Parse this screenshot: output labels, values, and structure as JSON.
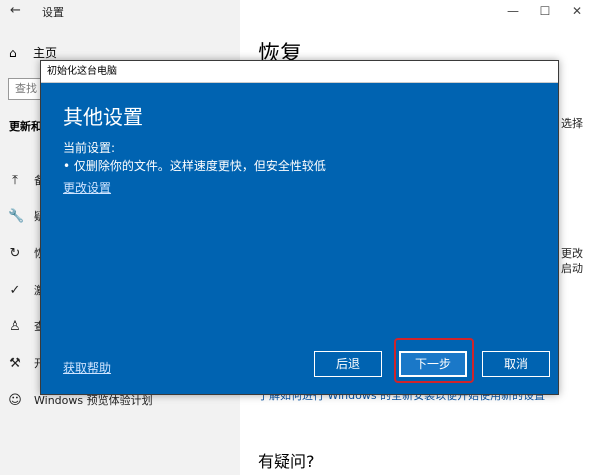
{
  "settings": {
    "back_icon": "←",
    "title": "设置",
    "window_controls": [
      "—",
      "☐",
      "✕"
    ],
    "home_label": "主页",
    "search_placeholder": "查找",
    "section_label": "更新和",
    "nav": [
      {
        "icon": "upload-icon",
        "glyph": "⤒",
        "label": "备"
      },
      {
        "icon": "wrench-icon",
        "glyph": "🔧",
        "label": "疑"
      },
      {
        "icon": "history-icon",
        "glyph": "↻",
        "label": "恢"
      },
      {
        "icon": "check-circle-icon",
        "glyph": "✓",
        "label": "激"
      },
      {
        "icon": "person-icon",
        "glyph": "♙",
        "label": "查"
      },
      {
        "icon": "developer-icon",
        "glyph": "⚒",
        "label": "开"
      },
      {
        "icon": "insider-icon",
        "glyph": "☺",
        "label": "Windows 预览体验计划"
      }
    ],
    "main_title": "恢复",
    "right_fragments": [
      "选择",
      "更改",
      "启动"
    ],
    "main_link": "了解如何进行 Windows 的全新安装以便开始使用新的设置",
    "question_title": "有疑问?"
  },
  "dialog": {
    "window_title": "初始化这台电脑",
    "heading": "其他设置",
    "current_label": "当前设置:",
    "bullet": "• 仅删除你的文件。这样速度更快，但安全性较低",
    "change_link": "更改设置",
    "help_link": "获取帮助",
    "back_button": "后退",
    "next_button": "下一步",
    "cancel_button": "取消"
  },
  "colors": {
    "dialog_bg": "#0063b1",
    "highlight": "#d0242b",
    "sidebar_bg": "#f2f2f2"
  }
}
